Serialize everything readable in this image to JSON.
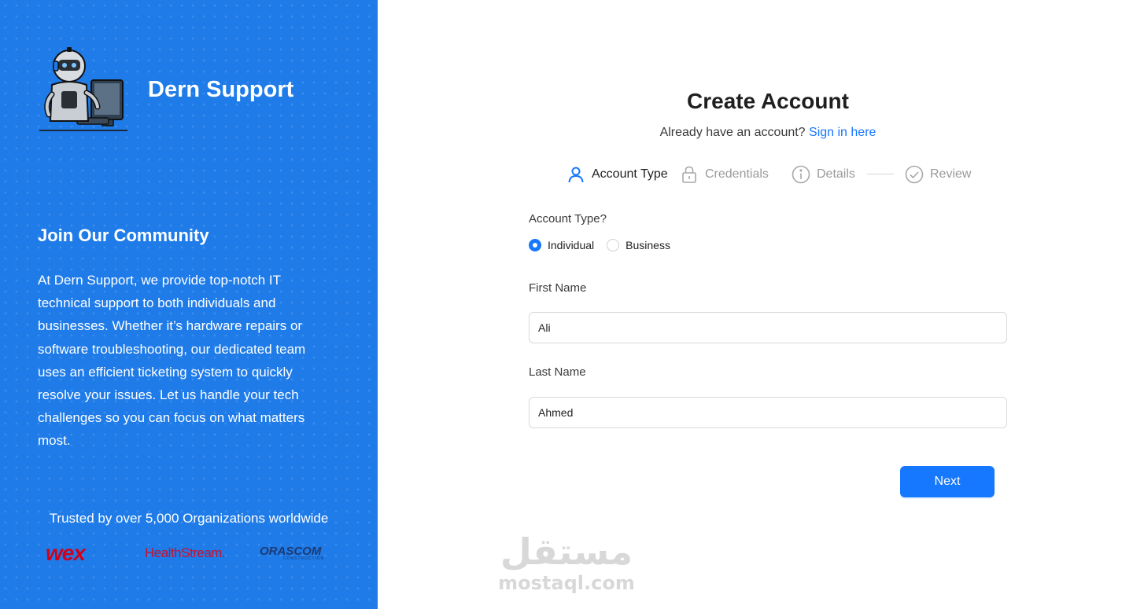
{
  "sidebar": {
    "brand_name": "Dern Support",
    "join_title": "Join Our Community",
    "join_text": "At Dern Support, we provide top-notch IT technical support to both individuals and businesses. Whether it’s hardware repairs or software troubleshooting, our dedicated team uses an efficient ticketing system to quickly resolve your issues. Let us handle your tech challenges so you can focus on what matters most.",
    "trusted_text": "Trusted by over 5,000 Organizations worldwide",
    "logos": [
      "wex",
      "HealthStream.",
      "ORASCOM"
    ],
    "logo_sub": "CONSTRUCTION",
    "bg_color": "#1e7be8"
  },
  "form": {
    "title": "Create Account",
    "subtitle_prefix": "Already have an account?",
    "signin_link": "Sign in here",
    "steps": [
      {
        "label": "Account Type",
        "icon": "user-icon",
        "state": "active"
      },
      {
        "label": "Credentials",
        "icon": "lock-icon",
        "state": "inactive"
      },
      {
        "label": "Details",
        "icon": "info-icon",
        "state": "inactive"
      },
      {
        "label": "Review",
        "icon": "check-circle-icon",
        "state": "inactive"
      }
    ],
    "account_type_label": "Account Type?",
    "account_type_options": [
      "Individual",
      "Business"
    ],
    "account_type_selected": "Individual",
    "first_name_label": "First Name",
    "first_name_value": "Ali",
    "last_name_label": "Last Name",
    "last_name_value": "Ahmed",
    "next_label": "Next",
    "accent_color": "#1677ff"
  },
  "watermark": {
    "arabic": "مستقل",
    "latin": "mostaql.com"
  }
}
